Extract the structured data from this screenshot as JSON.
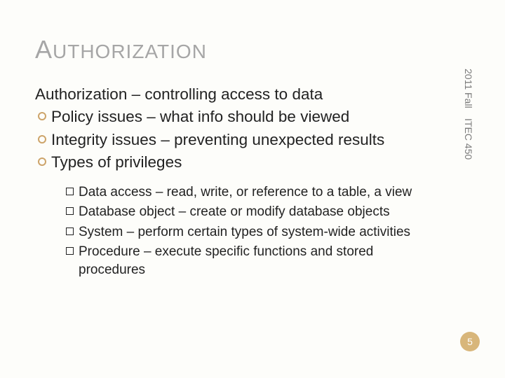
{
  "title": {
    "first": "A",
    "rest": "UTHORIZATION"
  },
  "lead": "Authorization – controlling access to data",
  "bullets": [
    "Policy issues – what info should be viewed",
    "Integrity issues – preventing unexpected results",
    "Types of privileges"
  ],
  "sub": [
    "Data access – read, write, or reference to a table, a view",
    "Database object – create or modify database objects",
    "System – perform certain types of system-wide activities",
    "Procedure – execute specific functions and stored procedures"
  ],
  "sidebar": {
    "term": "2011 Fall",
    "course": "ITEC 450"
  },
  "pagenum": "5"
}
